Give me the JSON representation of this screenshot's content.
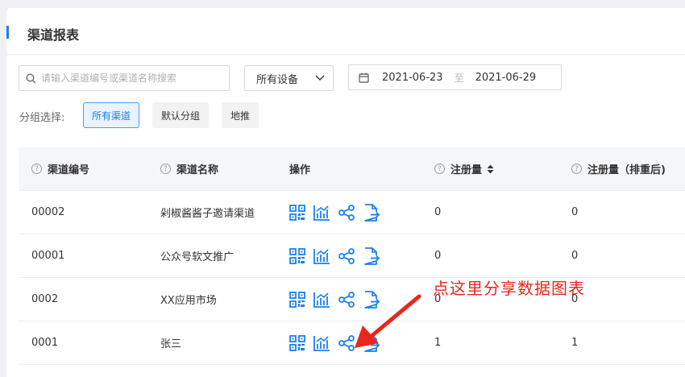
{
  "page": {
    "title": "渠道报表"
  },
  "filters": {
    "search_placeholder": "请输入渠道编号或渠道名称搜索",
    "device_select": "所有设备",
    "date_start": "2021-06-23",
    "date_sep": "至",
    "date_end": "2021-06-29",
    "group_label": "分组选择:",
    "groups": [
      "所有渠道",
      "默认分组",
      "地推"
    ],
    "active_group": "所有渠道"
  },
  "table": {
    "headers": [
      "渠道编号",
      "渠道名称",
      "操作",
      "注册量",
      "注册量（排重后)"
    ],
    "rows": [
      {
        "code": "00002",
        "name": "剁椒酱酱子邀请渠道",
        "reg": "0",
        "reg_dedup": "0"
      },
      {
        "code": "00001",
        "name": "公众号软文推广",
        "reg": "0",
        "reg_dedup": "0"
      },
      {
        "code": "0002",
        "name": "XX应用市场",
        "reg": "0",
        "reg_dedup": "0"
      },
      {
        "code": "0001",
        "name": "张三",
        "reg": "1",
        "reg_dedup": "1"
      }
    ],
    "op_icons": [
      "qrcode-icon",
      "chart-icon",
      "share-icon",
      "export-icon"
    ]
  },
  "annotation": {
    "text": "点这里分享数据图表",
    "color": "#e8261e"
  },
  "colors": {
    "accent": "#1a7ff0",
    "icon": "#1a7ff0"
  }
}
